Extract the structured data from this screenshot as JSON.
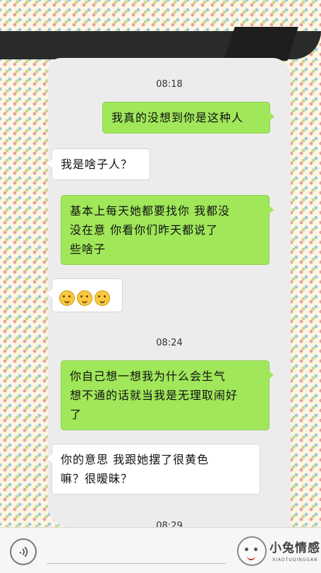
{
  "timestamps": [
    "08:18",
    "08:24",
    "08:29"
  ],
  "messages": [
    {
      "side": "out",
      "text": "我真的没想到你是这种人"
    },
    {
      "side": "in",
      "text": "我是啥子人？"
    },
    {
      "side": "out",
      "line1": "基本上每天她都要找你  我都没",
      "line2": "没在意   你看你们昨天都说了",
      "line3": "些啥子"
    },
    {
      "side": "in",
      "emoji": [
        "flushed-face-emoji",
        "flushed-face-emoji",
        "flushed-face-emoji"
      ]
    },
    {
      "side": "out",
      "line1": "你自己想一想我为什么会生气",
      "line2": "想不通的话就当我是无理取闹好",
      "line3": "了"
    },
    {
      "side": "in",
      "line1": "你的意思 我跟她摆了很黄色",
      "line2": "嘛？很暧昧？"
    }
  ],
  "bottom_bar": {
    "voice_icon": "voice-icon",
    "input_value": ""
  },
  "watermark": {
    "title": "小兔情感",
    "subtitle": "XIAOTUQINGGAN"
  },
  "colors": {
    "outgoing_bubble": "#a0e75a",
    "incoming_bubble": "#ffffff",
    "chat_background": "#ececec"
  }
}
